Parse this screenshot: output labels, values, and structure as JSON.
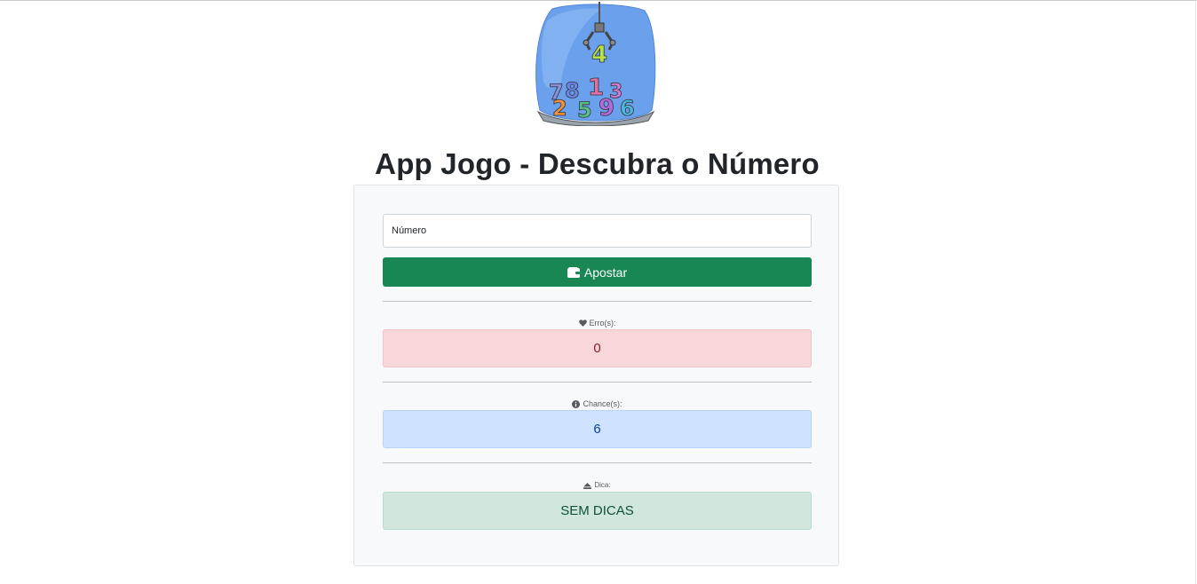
{
  "app": {
    "title": "App Jogo - Descubra o Número",
    "logo_digits": [
      "4",
      "7",
      "8",
      "1",
      "3",
      "2",
      "5",
      "9",
      "6"
    ]
  },
  "form": {
    "guess_placeholder": "Número",
    "submit_label": "Apostar",
    "submit_icon": "wallet-icon"
  },
  "stats": {
    "errors": {
      "label": "Erro(s):",
      "value": "0",
      "icon": "heart-icon"
    },
    "chances": {
      "label": "Chance(s):",
      "value": "6",
      "icon": "info-circle-icon"
    },
    "hint": {
      "label": "Dica:",
      "value": "SEM DICAS",
      "icon": "eject-icon"
    }
  },
  "colors": {
    "primary_button": "#198754",
    "danger_bg": "#f8d7da",
    "info_bg": "#cfe2ff",
    "success_bg": "#d1e7dd"
  }
}
